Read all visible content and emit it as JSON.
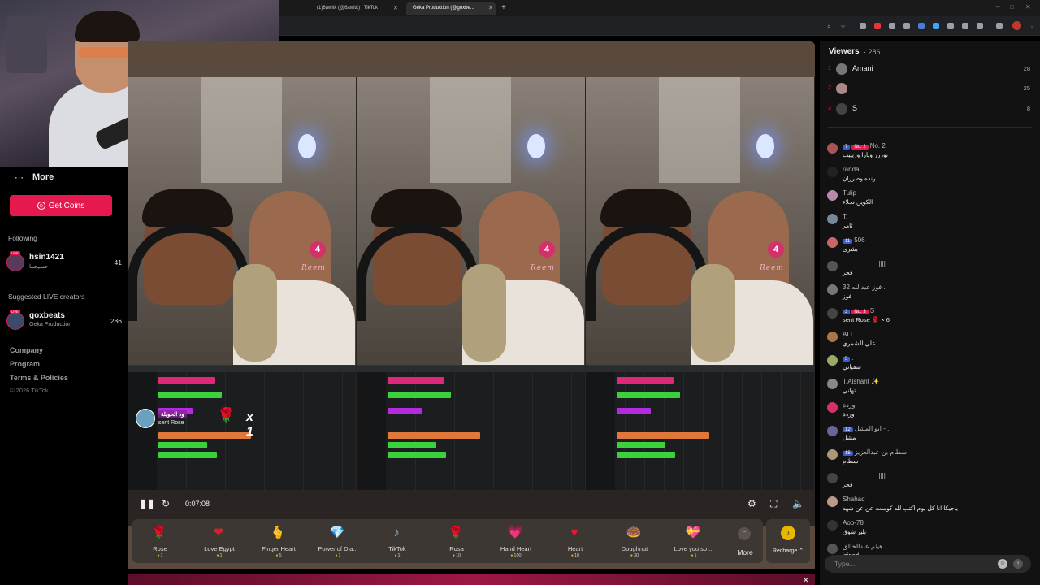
{
  "browser": {
    "tabs": [
      {
        "label": "(1)6awltk (@6awltk) | TikTok",
        "active": false
      },
      {
        "label": "Geka Production (@goxbe...",
        "active": true
      }
    ]
  },
  "sidebar": {
    "more_label": "More",
    "get_coins_label": "Get Coins",
    "following_title": "Following",
    "following": [
      {
        "name": "hsin1421",
        "sub": "حسيجما",
        "count": "41"
      }
    ],
    "suggested_title": "Suggested LIVE creators",
    "suggested": [
      {
        "name": "goxbeats",
        "sub": "Geka Production",
        "count": "286"
      }
    ],
    "footer_links": [
      "Company",
      "Program",
      "Terms & Policies"
    ],
    "copyright": "© 2026 TikTok"
  },
  "stream": {
    "panel_badge": "4",
    "panel_caption": "Reem",
    "gift_notice": {
      "name": "ود الحويلة",
      "action": "sent Rose",
      "mult": "x 1"
    },
    "time": "0:07:08"
  },
  "gifts": [
    {
      "name": "Rose",
      "price": "1",
      "icon": "rose-icon",
      "glyph": "🌹"
    },
    {
      "name": "Love Egypt",
      "price": "1",
      "icon": "egypt-heart-icon",
      "glyph": "❤"
    },
    {
      "name": "Finger Heart",
      "price": "5",
      "icon": "finger-heart-icon",
      "glyph": "🫰"
    },
    {
      "name": "Power of Dia...",
      "price": "1",
      "icon": "diamond-icon",
      "glyph": "💎"
    },
    {
      "name": "TikTok",
      "price": "1",
      "icon": "tiktok-icon",
      "glyph": "♪"
    },
    {
      "name": "Rosa",
      "price": "10",
      "icon": "rosa-icon",
      "glyph": "🌹"
    },
    {
      "name": "Hand Heart",
      "price": "100",
      "icon": "hand-heart-icon",
      "glyph": "💗"
    },
    {
      "name": "Heart",
      "price": "10",
      "icon": "heart-icon",
      "glyph": "♥"
    },
    {
      "name": "Doughnut",
      "price": "30",
      "icon": "doughnut-icon",
      "glyph": "🍩"
    },
    {
      "name": "Love you so ...",
      "price": "1",
      "icon": "love-you-icon",
      "glyph": "💝"
    }
  ],
  "gift_more_label": "More",
  "recharge_label": "Recharge ⌃",
  "chat": {
    "viewers_title": "Viewers",
    "viewers_count": "· 286",
    "top_viewers": [
      {
        "rank": "1",
        "name": "Amani",
        "score": "28"
      },
      {
        "rank": "2",
        "name": "",
        "score": "25"
      },
      {
        "rank": "3",
        "name": "S",
        "score": "8"
      }
    ],
    "messages": [
      {
        "name": "No. 2",
        "level": "7",
        "badge": "No. 2",
        "text": "نوررر ويارا وزيييب"
      },
      {
        "name": "randa",
        "level": "",
        "badge": "",
        "text": "رنده وطرزان"
      },
      {
        "name": "Tulip",
        "level": "",
        "badge": "",
        "text": "الكوين نجلاء"
      },
      {
        "name": "T.",
        "level": "",
        "badge": "",
        "text": "ثامر"
      },
      {
        "name": "506",
        "level": "11",
        "badge": "",
        "text": "بشرى"
      },
      {
        "name": "__________||||",
        "level": "",
        "badge": "",
        "text": "فجر"
      },
      {
        "name": "فوز عبدالله 32 .",
        "level": "",
        "badge": "",
        "text": "فوز"
      },
      {
        "name": "S",
        "level": "3",
        "badge": "No. 3",
        "text": "sent Rose 🌹 × 6"
      },
      {
        "name": "ALI",
        "level": "",
        "badge": "",
        "text": "علي الشمري"
      },
      {
        "name": ".",
        "level": "5",
        "badge": "",
        "text": "سفياني"
      },
      {
        "name": "T.Alsharif ✨",
        "level": "",
        "badge": "",
        "text": "تهاني"
      },
      {
        "name": "وردة",
        "level": "",
        "badge": "",
        "text": "وردة"
      },
      {
        "name": "ابو المشل - .",
        "level": "12",
        "badge": "",
        "text": "مشل"
      },
      {
        "name": "سطام بن عبدالعزيز",
        "level": "15",
        "badge": "",
        "text": "سطام"
      },
      {
        "name": "__________||||",
        "level": "",
        "badge": "",
        "text": "فجر"
      },
      {
        "name": "Shahad",
        "level": "",
        "badge": "",
        "text": "ياجيكا انا كل يوم اكتب لله كومنت عن عن شهد"
      },
      {
        "name": "Aop-78",
        "level": "",
        "badge": "",
        "text": "بليز شوق"
      },
      {
        "name": "هيثم عبدالخالق",
        "level": "",
        "badge": "",
        "text": "joined"
      }
    ],
    "input_placeholder": "Type..."
  }
}
